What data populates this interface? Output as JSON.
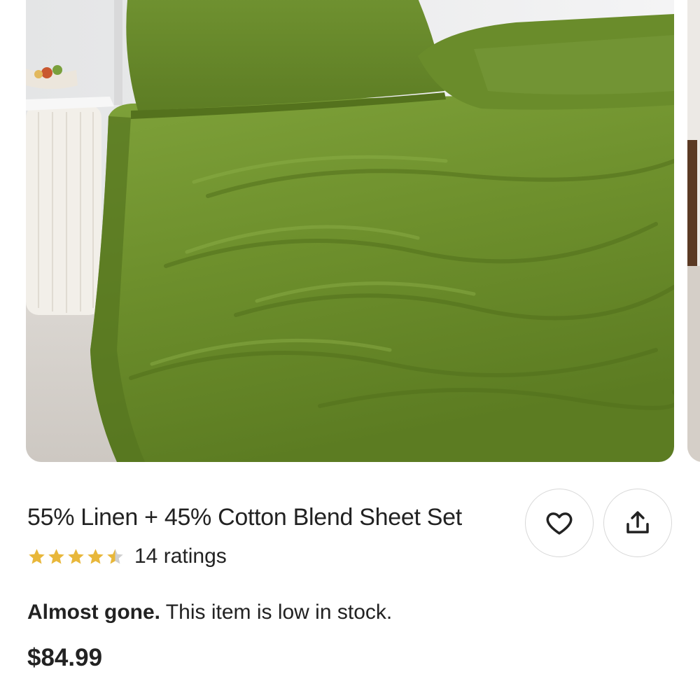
{
  "product": {
    "image_alt": "Olive green linen sheet set on a bed",
    "title": "55% Linen + 45% Cotton Blend Sheet Set",
    "rating": 4.5,
    "rating_max": 5,
    "rating_count_text": "14 ratings",
    "stock_bold": "Almost gone.",
    "stock_text": " This item is low in stock.",
    "price": "$84.99"
  },
  "actions": {
    "favorite_icon": "heart-icon",
    "share_icon": "share-icon"
  },
  "colors": {
    "star": "#E8B73A",
    "star_empty": "#cfcfcf",
    "sheet_green": "#6b8b2a",
    "text": "#222222"
  }
}
